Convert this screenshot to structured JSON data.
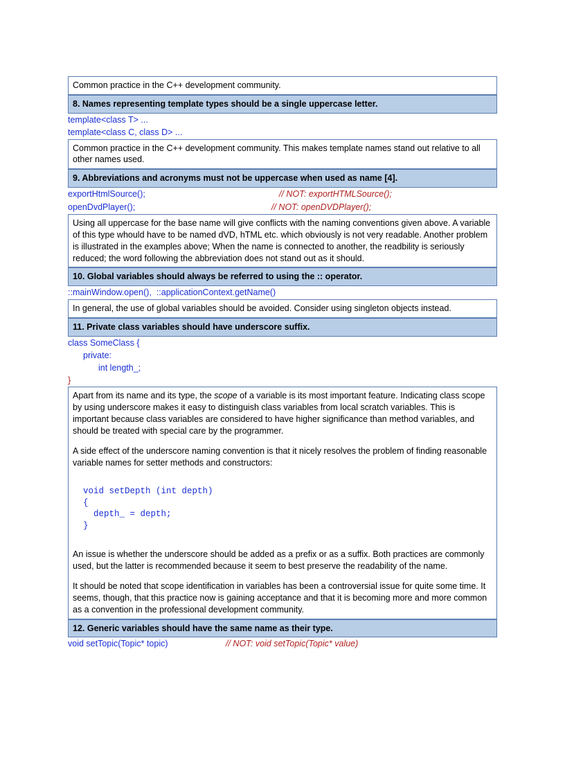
{
  "s7_body": "Common practice in the C++ development community.",
  "s8_heading": "8. Names representing template types should be a single uppercase letter.",
  "s8_code1": "template<class T> ...",
  "s8_code2": "template<class C, class D> ...",
  "s8_body": "Common practice in the C++ development community. This makes template names stand out relative to all other names used.",
  "s9_heading": "9. Abbreviations and acronyms must not be uppercase when used as name [4].",
  "s9_code1": "exportHtmlSource();",
  "s9_not1": "// NOT: exportHTMLSource();",
  "s9_code2": "openDvdPlayer();",
  "s9_not2": "// NOT: openDVDPlayer();",
  "s9_body": "Using all uppercase for the base name will give conflicts with the naming conventions given above. A variable of this type whould have to be named dVD, hTML etc. which obviously is not very readable. Another problem is illustrated in the examples above; When the name is connected to another, the readbility is seriously reduced; the word following the abbreviation does not stand out as it should.",
  "s10_heading": "10. Global variables should always be referred to using the :: operator.",
  "s10_code": "::mainWindow.open(),  ::applicationContext.getName()",
  "s10_body": "In general, the use of global variables should be avoided. Consider using singleton objects instead.",
  "s11_heading": "11. Private class variables should have underscore suffix.",
  "s11_code1": "class SomeClass {",
  "s11_code2": "private:",
  "s11_code3": "int length_;",
  "s11_code4": "}",
  "s11_p1a": "Apart from its name and its type, the ",
  "s11_p1_scope": "scope",
  "s11_p1b": " of a variable is its most important feature. Indicating class scope by using underscore makes it easy to distinguish class variables from local scratch variables. This is important because class variables are considered to have higher significance than method variables, and should be treated with special care by the programmer.",
  "s11_p2": "A side effect of the underscore naming convention is that it nicely resolves the problem of finding reasonable variable names for setter methods and constructors:",
  "s11_mono1": "  void setDepth (int depth)",
  "s11_mono2": "  {",
  "s11_mono3": "    depth_ = depth;",
  "s11_mono4": "  }",
  "s11_p3": "An issue is whether the underscore should be added as a prefix or as a suffix. Both practices are commonly used, but the latter is recommended because it seem to best preserve the readability of the name.",
  "s11_p4": "It should be noted that scope identification in variables has been a controversial issue for quite some time. It seems, though, that this practice now is gaining acceptance and that it is becoming more and more common as a convention in the professional development community.",
  "s12_heading": "12. Generic variables should have the same name as their type.",
  "s12_code": "void setTopic(Topic* topic)",
  "s12_not": "// NOT: void setTopic(Topic* value)"
}
